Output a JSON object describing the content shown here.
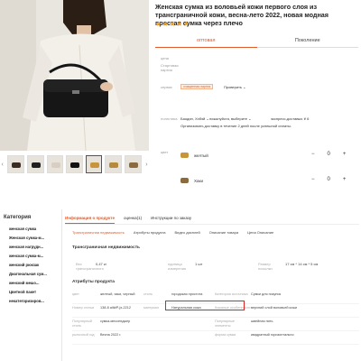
{
  "product": {
    "title": "Женская сумка из воловьей кожи первого слоя из трансграничной кожи, весна-лето 2022, новая модная простая сумка через плечо",
    "stars": "★★★★★",
    "tabs": [
      "оптовая",
      "Поколение"
    ],
    "price_labels": [
      "цена",
      "Стартовая партия"
    ],
    "service_label": "сервис",
    "service_badge": "очищенная партия",
    "service_link": "Проверить ⌄",
    "shipping_label": "логистика",
    "shipping_from": "Баодин, Хэбэй ⌄",
    "shipping_to": "пожалуйста, выберите ⌄",
    "shipping_fee": "экспресс-доставка: ¥ 6",
    "shipping_note": "Организовать доставку в течение 2 дней после успешной оплаты.",
    "color_label": "цвет",
    "variants": [
      {
        "name": "желтый",
        "qty": "0",
        "color": "#c9953a"
      },
      {
        "name": "Хаки",
        "qty": "0",
        "color": "#8b6a3e"
      }
    ],
    "qty_minus": "−",
    "qty_plus": "+"
  },
  "thumbs": {
    "colors": [
      "#3a2c22",
      "#202020",
      "#d8cfc2",
      "#111111",
      "#c9953a",
      "#b58a3a",
      "#8b6a3e"
    ],
    "prev": "‹",
    "next": "›"
  },
  "categories": {
    "title": "Категория",
    "items": [
      "женская сумка",
      "Женская сумка-м...",
      "женская нагрудн...",
      "женская сумка-м...",
      "женский рюкзак",
      "Диагональная сум...",
      "женский мешо...",
      "Цветной пакет",
      "некатегоризиров..."
    ]
  },
  "main_tabs": [
    "Информация о продукте",
    "оценка(1)",
    "Инструкции по заказу"
  ],
  "sub_tabs": [
    "Трансграничная недвижимость",
    "Атрибуты продукта",
    "Видео дисплей",
    "Описание товара",
    "Цена Описание"
  ],
  "cross_border": {
    "title": "Трансграничная недвижимость",
    "fields": [
      {
        "k": "Вес трансграничного",
        "v": "0,47 кг"
      },
      {
        "k": "единица измерения",
        "v": "1 шт"
      },
      {
        "k": "Размер посылки",
        "v": "17 см * 14 см * 5 см"
      }
    ]
  },
  "attributes": {
    "title": "Атрибуты продукта",
    "rows": [
      [
        {
          "k": "цвет",
          "v": "желтый, хаки, черный"
        },
        {
          "k": "стиль",
          "v": "городская простота"
        },
        {
          "k": "Категория источника",
          "v": "Сумки для покупок"
        }
      ],
      [
        {
          "k": "Номер статьи",
          "v": "138-8 allt#P-jx-2212"
        },
        {
          "k": "материал",
          "v": "Натуральная кожа"
        },
        {
          "k": "Кожаные особенности",
          "v": "верхний слой воловьей кожи"
        }
      ],
      [
        {
          "k": "Популярный стиль",
          "v": "сумка-мессенджер"
        },
        {
          "k": "",
          "v": ""
        },
        {
          "k": "Популярные элементы",
          "v": "швейная нить"
        }
      ],
      [
        {
          "k": "рыночный год",
          "v": "Весна 2022 г."
        },
        {
          "k": "",
          "v": ""
        },
        {
          "k": "форма сумки",
          "v": "квадратный горизонтально"
        }
      ]
    ]
  }
}
